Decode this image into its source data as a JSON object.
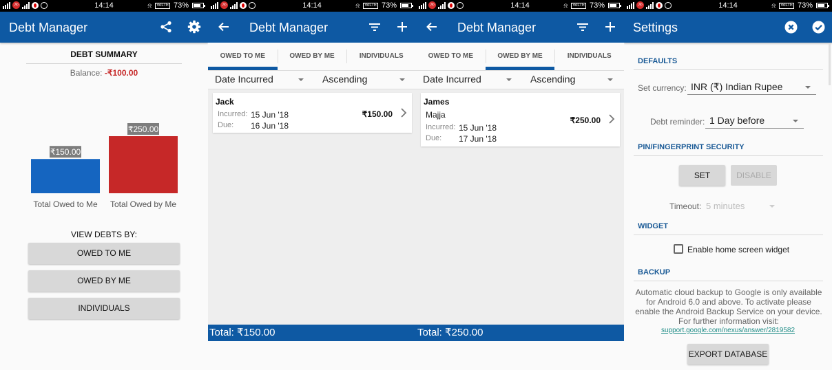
{
  "status_bar": {
    "time": "14:14",
    "battery": "73%",
    "volte": "VoLTE",
    "jio": "Jio"
  },
  "colors": {
    "primary": "#0e59a3",
    "owed_to_me": "#1565c0",
    "owed_by_me": "#c62828",
    "negative": "#c62828",
    "section": "#1a5a96",
    "link": "#1e8c86"
  },
  "summary_screen": {
    "title": "Debt Manager",
    "icons": {
      "share": "share-icon",
      "settings": "gear-icon"
    },
    "heading": "DEBT SUMMARY",
    "balance_label": "Balance: ",
    "balance_value": "-₹100.00",
    "view_by_label": "VIEW DEBTS BY:",
    "buttons": [
      "OWED TO ME",
      "OWED BY ME",
      "INDIVIDUALS"
    ]
  },
  "chart_data": {
    "type": "bar",
    "title": "",
    "categories": [
      "Total Owed to Me",
      "Total Owed by Me"
    ],
    "values": [
      150,
      250
    ],
    "value_labels": [
      "₹150.00",
      "₹250.00"
    ],
    "colors": [
      "#1565c0",
      "#c62828"
    ],
    "xlabel": "",
    "ylabel": "",
    "ylim": [
      0,
      250
    ],
    "grid": false,
    "legend": "none"
  },
  "tabs": [
    "OWED TO ME",
    "OWED BY ME",
    "INDIVIDUALS"
  ],
  "sort": {
    "field": "Date Incurred",
    "order": "Ascending"
  },
  "owed_to_me_screen": {
    "title": "Debt Manager",
    "active_tab": 0,
    "debts": [
      {
        "name": "Jack",
        "note": "",
        "incurred_label": "Incurred:",
        "incurred": "15 Jun '18",
        "due_label": "Due:",
        "due": "16 Jun '18",
        "amount": "₹150.00"
      }
    ],
    "total": "Total: ₹150.00"
  },
  "owed_by_me_screen": {
    "title": "Debt Manager",
    "active_tab": 1,
    "debts": [
      {
        "name": "James",
        "note": "Majja",
        "incurred_label": "Incurred:",
        "incurred": "15 Jun '18",
        "due_label": "Due:",
        "due": "17 Jun '18",
        "amount": "₹250.00"
      }
    ],
    "total": "Total: ₹250.00"
  },
  "settings_screen": {
    "title": "Settings",
    "sections": {
      "defaults": "DEFAULTS",
      "security": "PIN/FINGERPRINT SECURITY",
      "widget": "WIDGET",
      "backup": "BACKUP"
    },
    "currency_label": "Set currency:",
    "currency_value": "INR (₹) Indian Rupee",
    "reminder_label": "Debt reminder:",
    "reminder_value": "1 Day before",
    "set_button": "SET",
    "disable_button": "DISABLE",
    "timeout_label": "Timeout:",
    "timeout_value": "5 minutes",
    "widget_checkbox_label": "Enable home screen widget",
    "widget_checked": false,
    "backup_text": "Automatic cloud backup to Google is only available for Android 6.0 and above. To activate please enable the Android Backup Service on your device. For further information visit:",
    "backup_link": "support.google.com/nexus/answer/2819582",
    "export_button": "EXPORT DATABASE"
  }
}
